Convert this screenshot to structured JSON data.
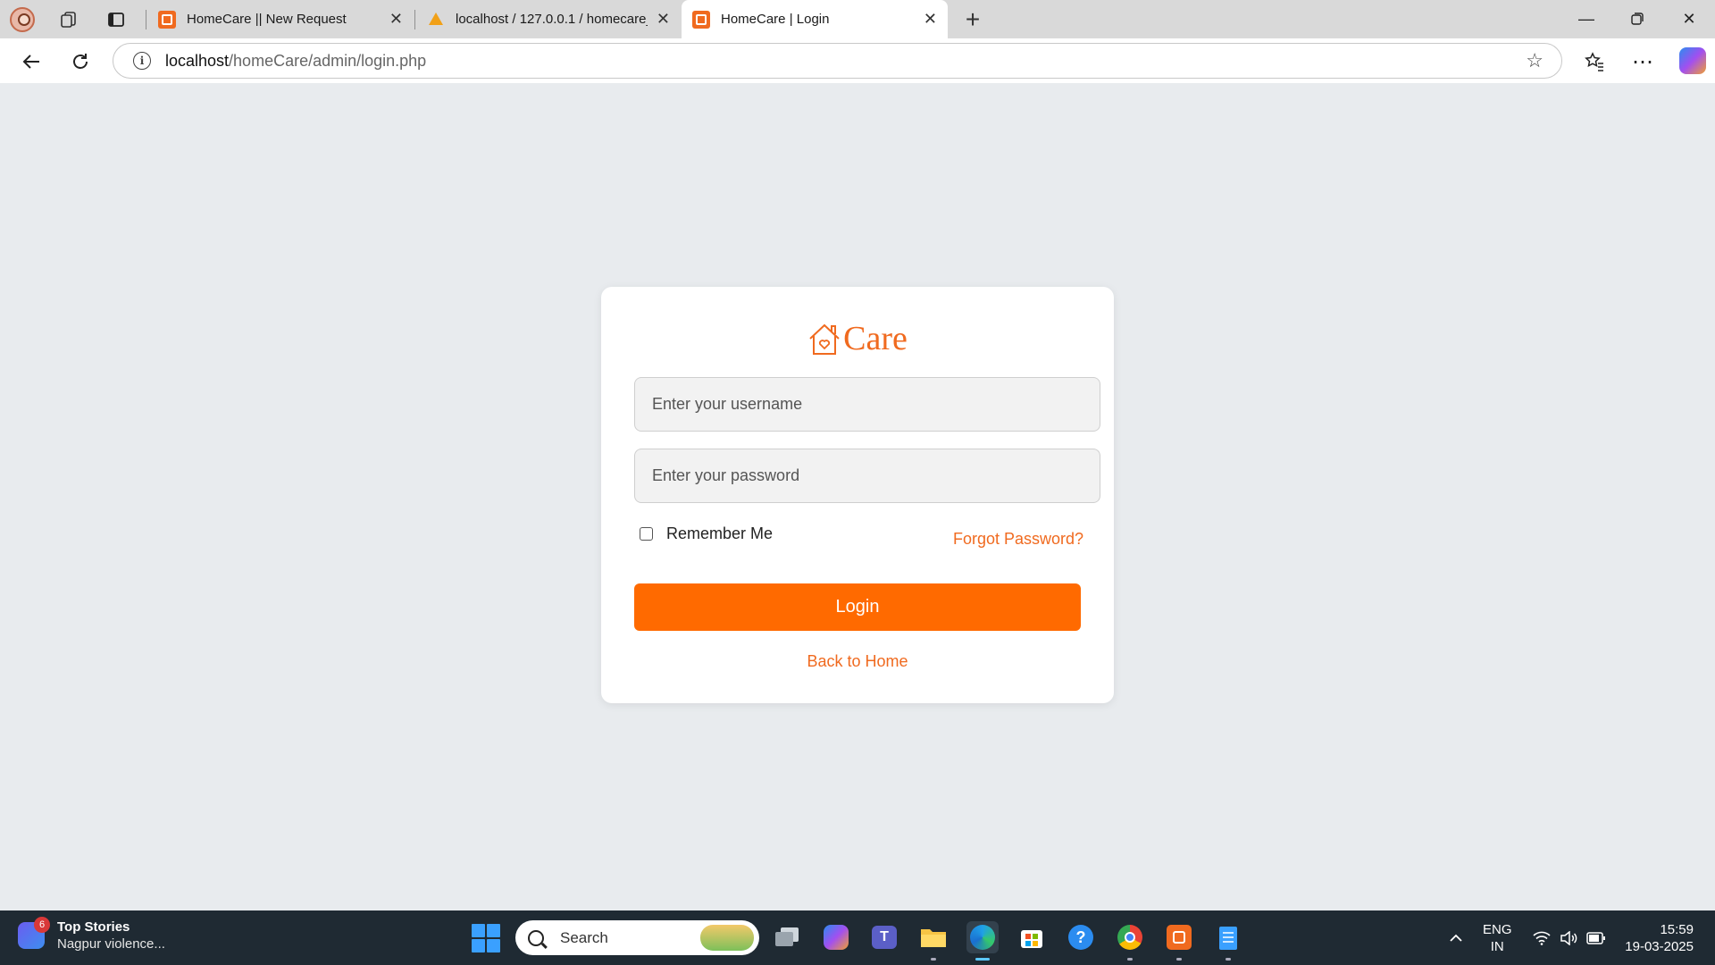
{
  "browser": {
    "tabs": [
      {
        "title": "HomeCare || New Request",
        "active": false,
        "favicon": "xampp-icon"
      },
      {
        "title": "localhost / 127.0.0.1 / homecare_c",
        "active": false,
        "favicon": "phpmyadmin-icon"
      },
      {
        "title": "HomeCare | Login",
        "active": true,
        "favicon": "xampp-icon"
      }
    ],
    "url_host": "localhost",
    "url_path": "/homeCare/admin/login.php"
  },
  "login": {
    "brand_text": "Care",
    "username_placeholder": "Enter your username",
    "password_placeholder": "Enter your password",
    "remember_label": "Remember Me",
    "forgot_label": "Forgot Password?",
    "login_button": "Login",
    "back_home": "Back to Home"
  },
  "colors": {
    "accent": "#ff6a00",
    "accent_text": "#f06a1f",
    "page_bg": "#e8ebee"
  },
  "taskbar": {
    "news_badge": "6",
    "news_title": "Top Stories",
    "news_subtitle": "Nagpur violence...",
    "search_label": "Search",
    "lang_line1": "ENG",
    "lang_line2": "IN",
    "time": "15:59",
    "date": "19-03-2025"
  }
}
